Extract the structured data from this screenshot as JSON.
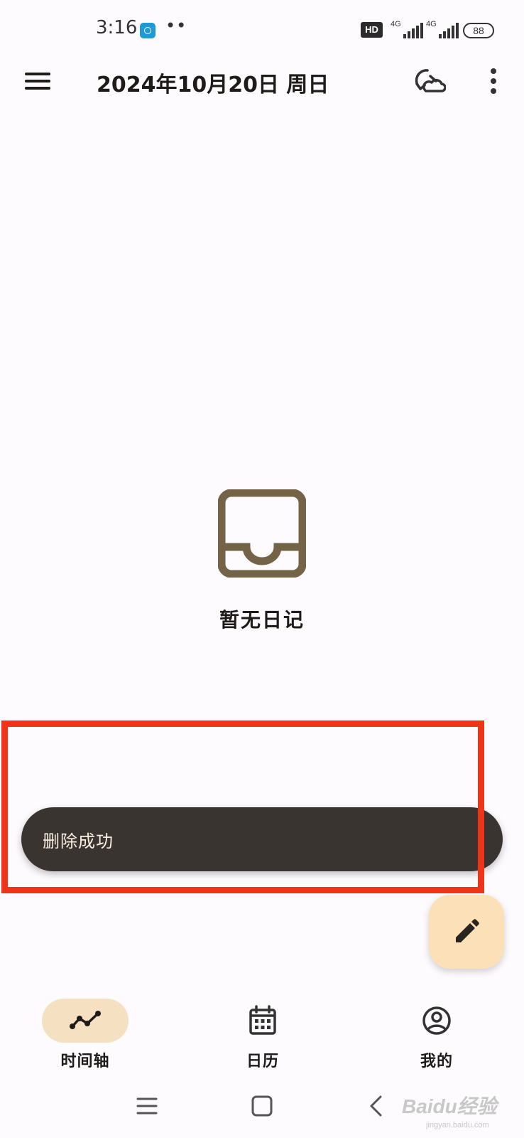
{
  "status_bar": {
    "time": "3:16",
    "dots": "••",
    "hd_badge": "HD",
    "network_1": "4G",
    "network_2": "4G",
    "battery": "88"
  },
  "app_bar": {
    "title": "2024年10月20日 周日"
  },
  "empty_state": {
    "text": "暂无日记"
  },
  "snackbar": {
    "message": "删除成功"
  },
  "bottom_nav": {
    "items": [
      {
        "label": "时间轴",
        "icon": "timeline-icon",
        "active": true
      },
      {
        "label": "日历",
        "icon": "calendar-icon",
        "active": false
      },
      {
        "label": "我的",
        "icon": "account-circle-icon",
        "active": false
      }
    ]
  },
  "watermark": {
    "brand": "Baidu经验",
    "url": "jingyan.baidu.com"
  },
  "colors": {
    "background": "#fdfbfd",
    "accent_container": "#fce1b8",
    "nav_active_pill": "#f5e0c2",
    "snackbar_bg": "#3a3430",
    "icon_brown": "#746347",
    "highlight_red": "#ef3418"
  }
}
